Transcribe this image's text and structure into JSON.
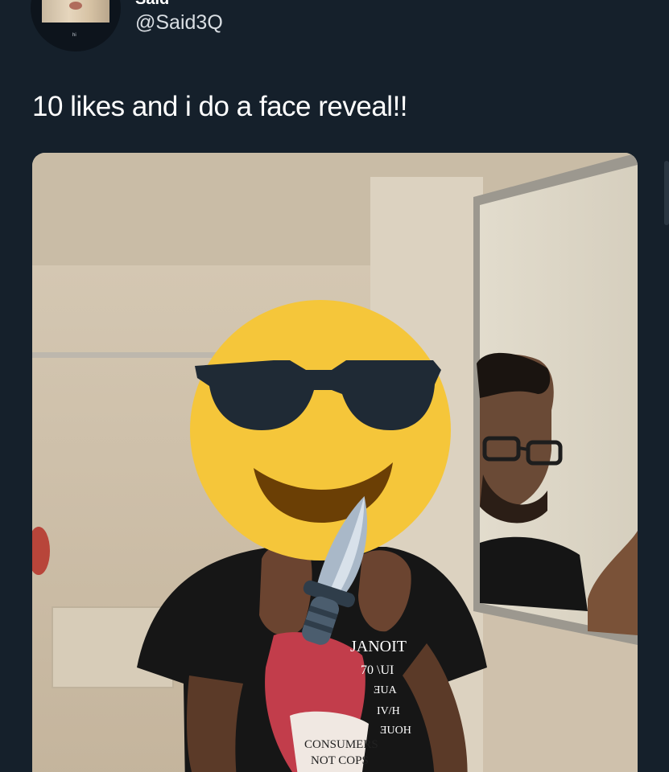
{
  "tweet": {
    "display_name": "Said",
    "handle": "@Said3Q",
    "text": "10 likes and i do a face reveal!!",
    "avatar_caption": "hi"
  },
  "photo": {
    "shirt_text_lines": [
      "JANOIT",
      "70 \\UI",
      "ƎUA",
      "IV/H",
      "ƎUOH"
    ],
    "badge_lines": [
      "CONSUMERS",
      "NOT COPS"
    ]
  },
  "colors": {
    "background": "#15202b",
    "text": "#ffffff",
    "secondary_text": "#d9dee3",
    "emoji_yellow": "#f5c63a",
    "knife_blade": "#a9b8c8"
  },
  "icons": {
    "overlay_emoji": "smiling-face-with-sunglasses-icon",
    "knife": "knife-icon"
  }
}
